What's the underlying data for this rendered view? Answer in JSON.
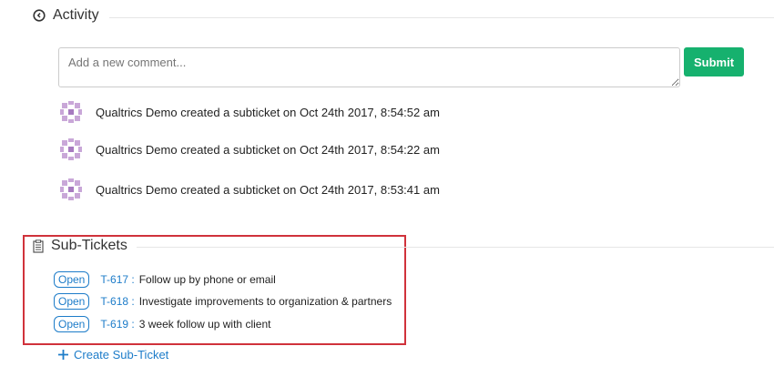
{
  "activity": {
    "title": "Activity",
    "placeholder": "Add a new comment...",
    "submit": "Submit",
    "items": [
      {
        "text": "Qualtrics Demo created a subticket on Oct 24th 2017, 8:54:52 am"
      },
      {
        "text": "Qualtrics Demo created a subticket on Oct 24th 2017, 8:54:22 am"
      },
      {
        "text": "Qualtrics Demo created a subticket on Oct 24th 2017, 8:53:41 am"
      }
    ]
  },
  "subtickets": {
    "title": "Sub-Tickets",
    "create": "Create Sub-Ticket",
    "items": [
      {
        "status": "Open",
        "id": "T-617 :",
        "title": "Follow up by phone or email"
      },
      {
        "status": "Open",
        "id": "T-618 :",
        "title": "Investigate improvements to organization & partners"
      },
      {
        "status": "Open",
        "id": "T-619 :",
        "title": "3 week follow up with client"
      }
    ]
  },
  "colors": {
    "accent": "#1d7cc9",
    "submit": "#16b16e",
    "highlight": "#d0323b"
  }
}
